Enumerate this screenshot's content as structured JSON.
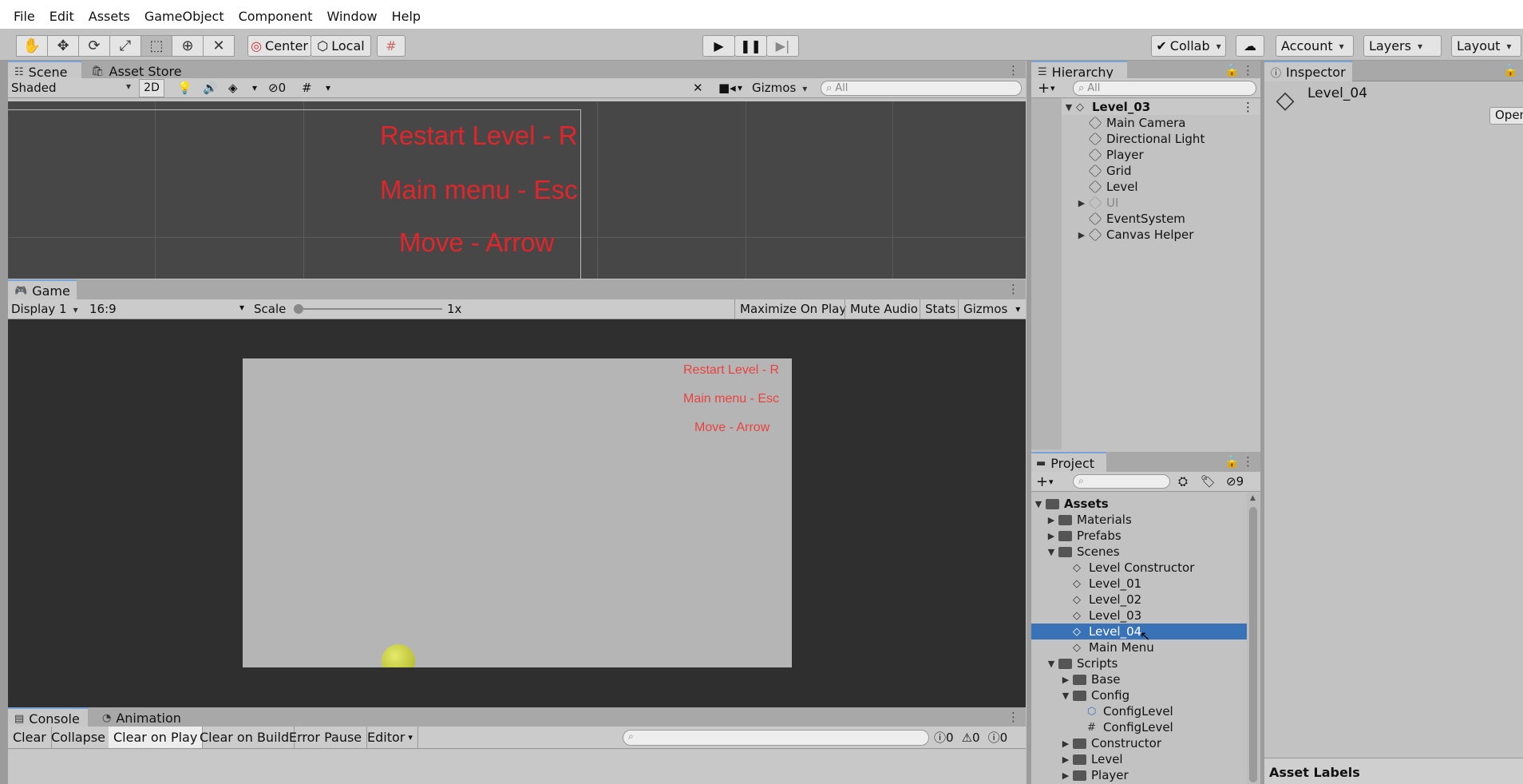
{
  "menu": [
    "File",
    "Edit",
    "Assets",
    "GameObject",
    "Component",
    "Window",
    "Help"
  ],
  "toolbar": {
    "pivot_label": "Center",
    "space_label": "Local",
    "collab_label": "Collab",
    "account_label": "Account",
    "layers_label": "Layers",
    "layout_label": "Layout"
  },
  "scene": {
    "tabs": [
      "Scene",
      "Asset Store"
    ],
    "shading": "Shaded",
    "mode_2d": "2D",
    "hidden_count": "0",
    "gizmos_label": "Gizmos",
    "search_placeholder": "All",
    "texts": [
      "Restart Level - R",
      "Main menu - Esc",
      "Move - Arrow"
    ]
  },
  "game": {
    "tab": "Game",
    "display": "Display 1",
    "aspect": "16:9",
    "scale_label": "Scale",
    "scale_value": "1x",
    "maximize_label": "Maximize On Play",
    "mute_label": "Mute Audio",
    "stats_label": "Stats",
    "gizmos_label": "Gizmos",
    "texts": [
      "Restart Level - R",
      "Main menu - Esc",
      "Move - Arrow"
    ]
  },
  "console": {
    "tabs": [
      "Console",
      "Animation"
    ],
    "buttons": [
      "Clear",
      "Collapse",
      "Clear on Play",
      "Clear on Build",
      "Error Pause",
      "Editor"
    ],
    "counts": {
      "info": "0",
      "warn": "0",
      "error": "0"
    }
  },
  "hierarchy": {
    "tab": "Hierarchy",
    "search_placeholder": "All",
    "scene": "Level_03",
    "items": [
      "Main Camera",
      "Directional Light",
      "Player",
      "Grid",
      "Level",
      "UI",
      "EventSystem",
      "Canvas Helper"
    ]
  },
  "project": {
    "tab": "Project",
    "hidden_count": "9",
    "root": "Assets",
    "folders": [
      "Materials",
      "Prefabs",
      "Scenes"
    ],
    "scenes": [
      "Level Constructor",
      "Level_01",
      "Level_02",
      "Level_03",
      "Level_04",
      "Main Menu"
    ],
    "scripts_folder": "Scripts",
    "scripts_children": [
      "Base",
      "Config"
    ],
    "config_children": [
      "ConfigLevel",
      "ConfigLevel"
    ],
    "more_folders": [
      "Constructor",
      "Level",
      "Player"
    ]
  },
  "inspector": {
    "tab": "Inspector",
    "object_name": "Level_04",
    "open_label": "Open",
    "asset_labels": "Asset Labels"
  }
}
